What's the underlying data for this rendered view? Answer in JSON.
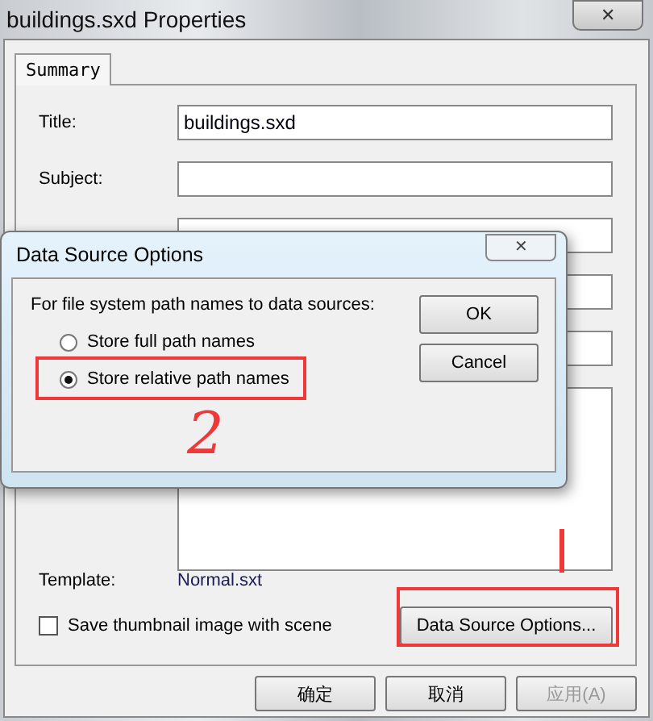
{
  "window": {
    "title": "buildings.sxd Properties",
    "close": "✕"
  },
  "tabs": [
    {
      "label": "Summary",
      "selected": true
    }
  ],
  "fields": [
    {
      "label": "Title:",
      "value": "buildings.sxd",
      "kind": "line"
    },
    {
      "label": "Subject:",
      "kind": "line"
    },
    {
      "kind": "line"
    },
    {
      "kind": "line"
    },
    {
      "kind": "line"
    },
    {
      "kind": "multi"
    }
  ],
  "template": {
    "label": "Template:",
    "value": "Normal.sxt"
  },
  "thumbnail": {
    "label": "Save thumbnail image with scene",
    "checked": false
  },
  "data_source_button": "Data Source Options...",
  "buttons": [
    {
      "label": "确定",
      "disabled": false
    },
    {
      "label": "取消",
      "disabled": false
    },
    {
      "label": "应用(A)",
      "disabled": true
    }
  ],
  "dialog": {
    "title": "Data Source Options",
    "close": "✕",
    "prompt": "For file system path names to data sources:",
    "options": [
      {
        "label": "Store full path names",
        "selected": false
      },
      {
        "label": "Store relative path names",
        "selected": true
      }
    ],
    "buttons": [
      "OK",
      "Cancel"
    ]
  },
  "annotations": [
    {
      "kind": "line"
    },
    {
      "kind": "number",
      "label": "2"
    }
  ]
}
